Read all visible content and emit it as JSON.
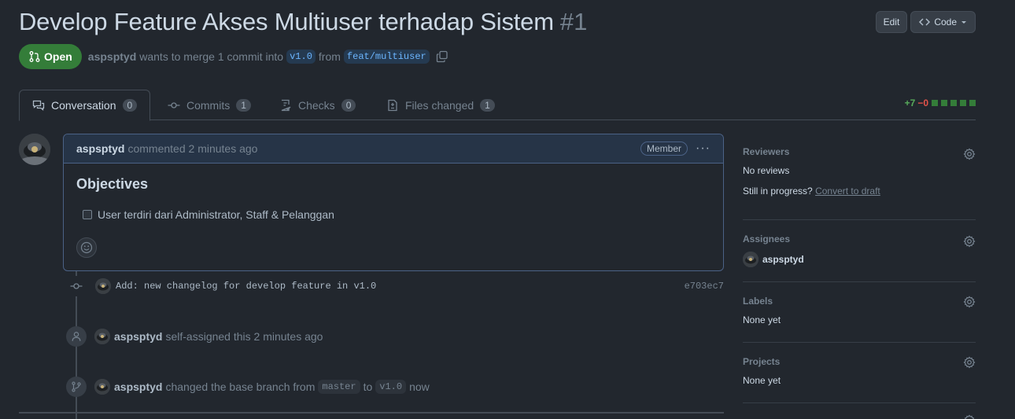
{
  "pr": {
    "title": "Develop Feature Akses Multiuser terhadap Sistem",
    "number": "#1",
    "state": "Open",
    "author": "aspsptyd",
    "merge_text": "wants to merge 1 commit into",
    "base_branch": "v1.0",
    "from_text": "from",
    "head_branch": "feat/multiuser"
  },
  "header": {
    "edit_label": "Edit",
    "code_label": "Code"
  },
  "tabs": [
    {
      "label": "Conversation",
      "count": "0"
    },
    {
      "label": "Commits",
      "count": "1"
    },
    {
      "label": "Checks",
      "count": "0"
    },
    {
      "label": "Files changed",
      "count": "1"
    }
  ],
  "diffstat": {
    "additions": "+7",
    "deletions": "−0"
  },
  "comment": {
    "author": "aspsptyd",
    "action": "commented",
    "time": "2 minutes ago",
    "role": "Member",
    "heading": "Objectives",
    "task": "User terdiri dari Administrator, Staff & Pelanggan"
  },
  "timeline": {
    "commit_message": "Add: new changelog for develop feature in v1.0",
    "commit_sha": "e703ec7",
    "assign_user": "aspsptyd",
    "assign_text": "self-assigned this 2 minutes ago",
    "branch_user": "aspsptyd",
    "branch_text": "changed the base branch from",
    "old_branch": "master",
    "to_text": "to",
    "new_branch": "v1.0",
    "now_text": "now"
  },
  "sidebar": {
    "reviewers_title": "Reviewers",
    "reviewers_value": "No reviews",
    "in_progress_text": "Still in progress?",
    "convert_link": "Convert to draft",
    "assignees_title": "Assignees",
    "assignee": "aspsptyd",
    "labels_title": "Labels",
    "labels_value": "None yet",
    "projects_title": "Projects",
    "projects_value": "None yet"
  },
  "colors": {
    "open_green": "#347d39",
    "accent_blue": "#6cb6ff",
    "bg": "#22272e"
  }
}
